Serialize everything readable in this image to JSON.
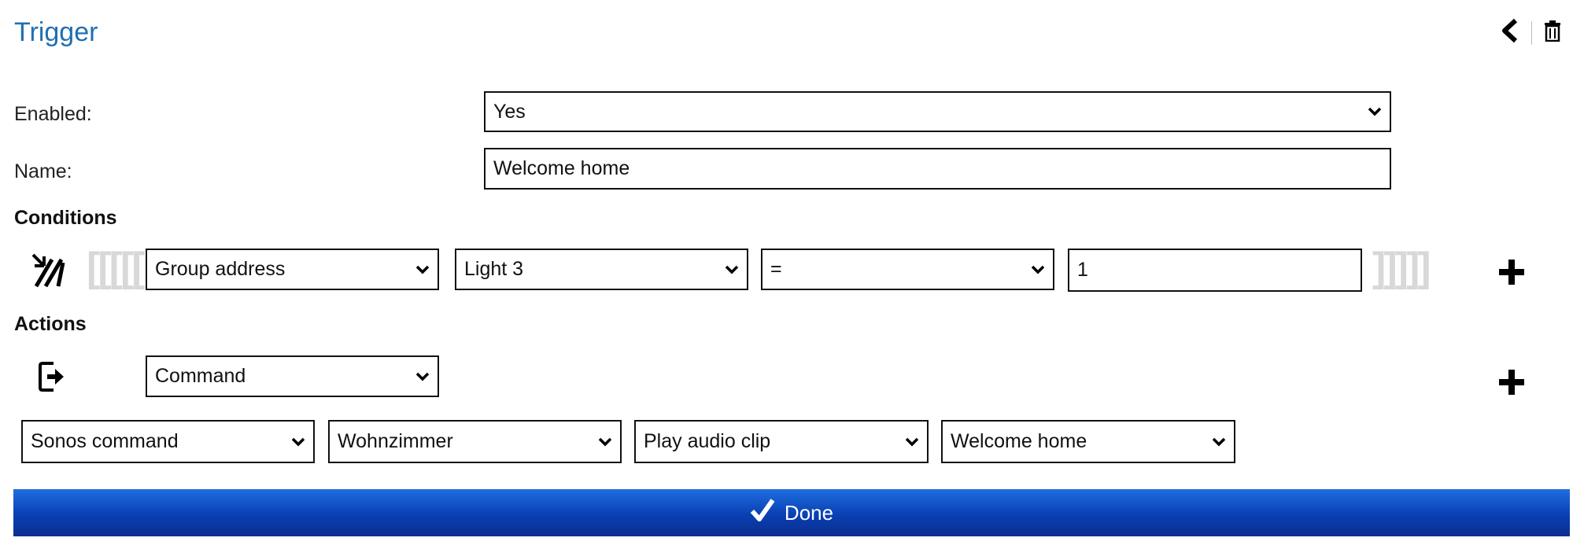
{
  "header": {
    "title": "Trigger",
    "icons": {
      "back": "chevron-left-icon",
      "delete": "trash-icon"
    }
  },
  "form": {
    "enabled_label": "Enabled:",
    "enabled_value": "Yes",
    "name_label": "Name:",
    "name_value": "Welcome home"
  },
  "conditions": {
    "heading": "Conditions",
    "icon": "trigger-signal-icon",
    "open_bracket": "[[[[[",
    "close_bracket": "]]]]]",
    "type": "Group address",
    "target": "Light 3",
    "operator": "=",
    "value": "1",
    "add_icon": "plus-icon"
  },
  "actions": {
    "heading": "Actions",
    "icon": "exit-arrow-icon",
    "type": "Command",
    "add_icon": "plus-icon",
    "params": [
      "Sonos command",
      "Wohnzimmer",
      "Play audio clip",
      "Welcome home"
    ]
  },
  "done_button": {
    "label": "Done",
    "icon": "checkmark-icon"
  },
  "colors": {
    "title": "#1f6fb2",
    "done_bg": "#0a3fb3"
  }
}
